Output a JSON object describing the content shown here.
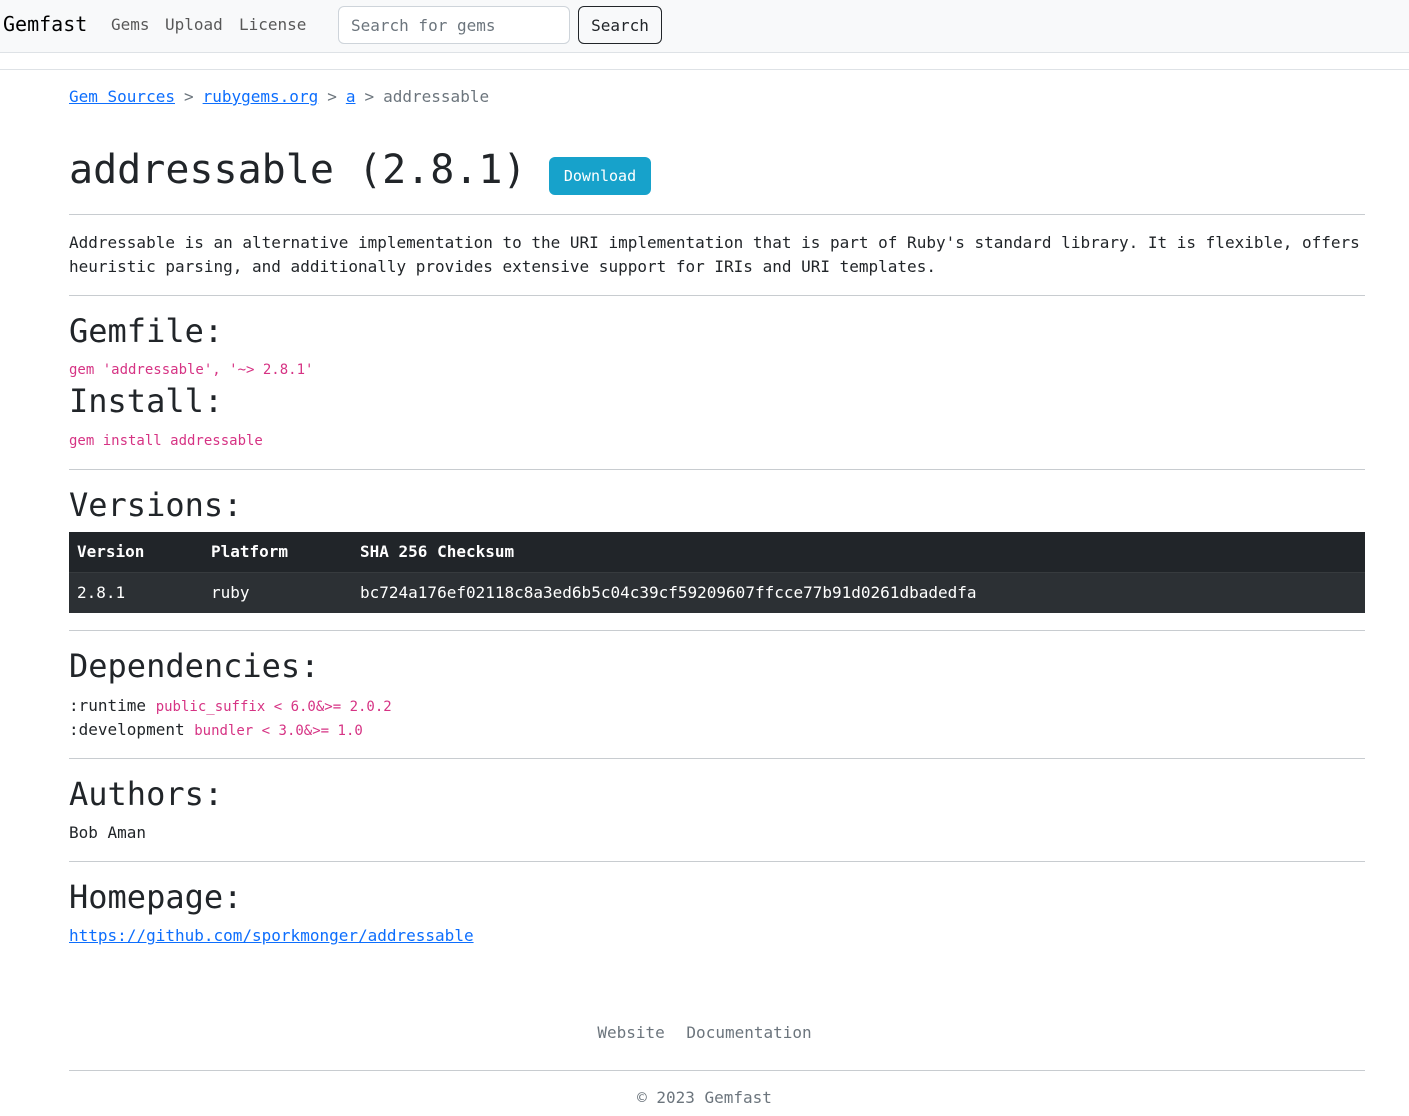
{
  "nav": {
    "brand": "Gemfast",
    "links": [
      "Gems",
      "Upload",
      "License"
    ],
    "search_placeholder": "Search for gems",
    "search_button": "Search"
  },
  "breadcrumb": {
    "items": [
      "Gem Sources",
      "rubygems.org",
      "a"
    ],
    "separator": ">",
    "current": "addressable"
  },
  "gem": {
    "title": "addressable (2.8.1)",
    "download_label": "Download",
    "description": "Addressable is an alternative implementation to the URI implementation that is part of Ruby's standard library. It is flexible, offers heuristic parsing, and additionally provides extensive support for IRIs and URI templates."
  },
  "gemfile": {
    "heading": "Gemfile:",
    "code": "gem 'addressable', '~> 2.8.1'"
  },
  "install": {
    "heading": "Install:",
    "code": "gem install addressable"
  },
  "versions": {
    "heading": "Versions:",
    "columns": [
      "Version",
      "Platform",
      "SHA 256 Checksum"
    ],
    "rows": [
      [
        "2.8.1",
        "ruby",
        "bc724a176ef02118c8a3ed6b5c04c39cf59209607ffcce77b91d0261dbadedfa"
      ]
    ]
  },
  "dependencies": {
    "heading": "Dependencies:",
    "items": [
      {
        "type": ":runtime",
        "spec": "public_suffix < 6.0&>= 2.0.2"
      },
      {
        "type": ":development",
        "spec": "bundler < 3.0&>= 1.0"
      }
    ]
  },
  "authors": {
    "heading": "Authors:",
    "value": "Bob Aman"
  },
  "homepage": {
    "heading": "Homepage:",
    "url": "https://github.com/sporkmonger/addressable"
  },
  "footer": {
    "links": [
      "Website",
      "Documentation"
    ],
    "copyright": "© 2023 Gemfast"
  },
  "colors": {
    "navbar_bg": "#f8f9fa",
    "link": "#0d6efd",
    "code": "#d63384",
    "download_button": "#17a2cb",
    "table_bg": "#212529"
  }
}
